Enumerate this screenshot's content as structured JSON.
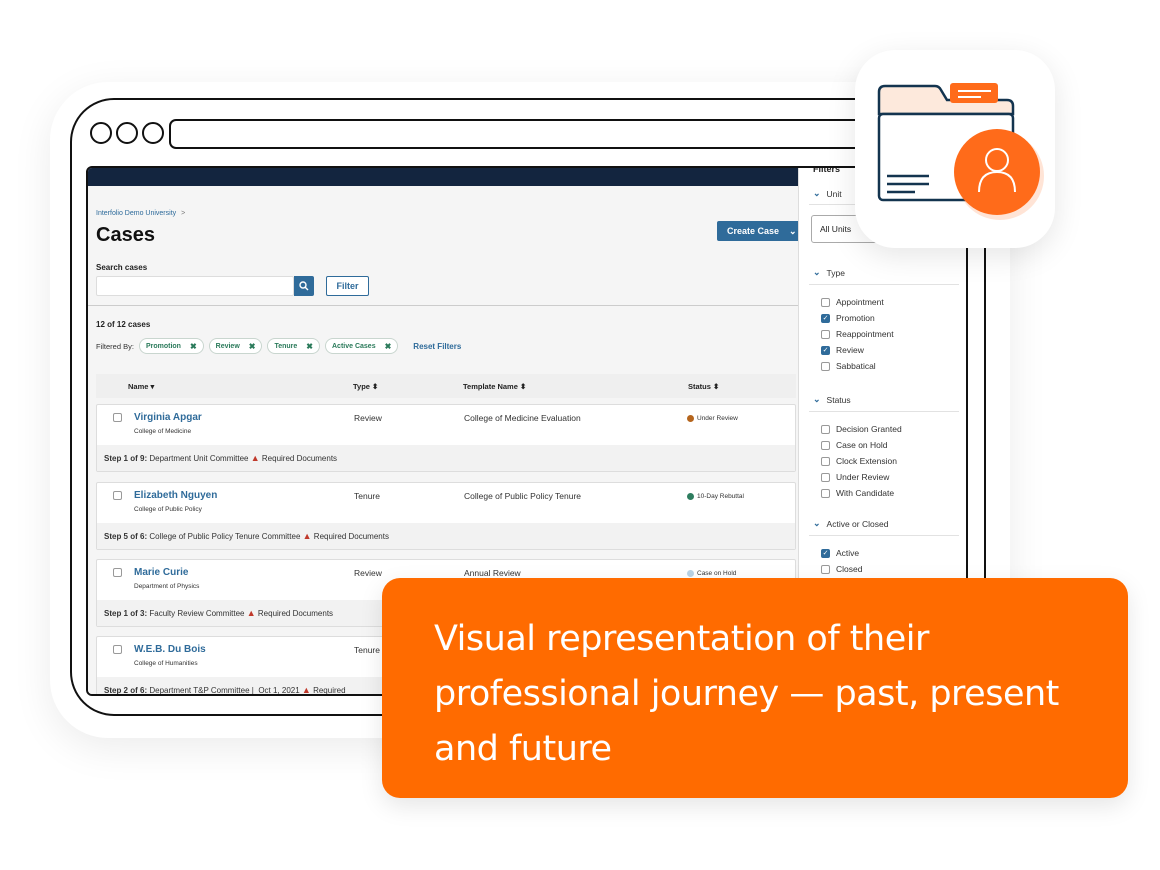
{
  "browser": {
    "window_controls": [
      "circle",
      "circle",
      "circle"
    ],
    "url": ""
  },
  "app": {
    "breadcrumb": "Interfolio Demo University",
    "breadcrumb_separator": ">",
    "page_title": "Cases",
    "create_button": "Create Case",
    "search_label": "Search cases",
    "search_value": "",
    "search_icon": "search-icon",
    "filter_button": "Filter",
    "case_count": "12 of 12 cases",
    "filtered_by_label": "Filtered By:",
    "filter_chips": [
      {
        "label": "Promotion",
        "remove": "✖"
      },
      {
        "label": "Review",
        "remove": "✖"
      },
      {
        "label": "Tenure",
        "remove": "✖"
      },
      {
        "label": "Active Cases",
        "remove": "✖"
      }
    ],
    "reset_filters": "Reset Filters",
    "table": {
      "columns": [
        {
          "label": "Name",
          "sort": "▾"
        },
        {
          "label": "Type",
          "sort": "⬍"
        },
        {
          "label": "Template Name",
          "sort": "⬍"
        },
        {
          "label": "Status",
          "sort": "⬍"
        }
      ],
      "rows": [
        {
          "name": "Virginia Apgar",
          "unit": "College of Medicine",
          "type": "Review",
          "template": "College of Medicine Evaluation",
          "status": "Under Review",
          "status_color": "#b5651d",
          "step_prefix": "Step 1 of 9:",
          "step_text": "Department Unit Committee",
          "step_date": "",
          "warning": "Required Documents"
        },
        {
          "name": "Elizabeth Nguyen",
          "unit": "College of Public Policy",
          "type": "Tenure",
          "template": "College of Public Policy Tenure",
          "status": "10-Day Rebuttal",
          "status_color": "#2e7d5f",
          "step_prefix": "Step 5 of 6:",
          "step_text": "College of Public Policy Tenure Committee",
          "step_date": "",
          "warning": "Required Documents"
        },
        {
          "name": "Marie Curie",
          "unit": "Department of Physics",
          "type": "Review",
          "template": "Annual Review",
          "status": "Case on Hold",
          "status_color": "#b9d3e6",
          "step_prefix": "Step 1 of 3:",
          "step_text": "Faculty Review Committee",
          "step_date": "",
          "warning": "Required Documents"
        },
        {
          "name": "W.E.B. Du Bois",
          "unit": "College of Humanities",
          "type": "Tenure",
          "template": "",
          "status": "",
          "status_color": "",
          "step_prefix": "Step 2 of 6:",
          "step_text": "Department T&P Committee |",
          "step_date": "Oct 1, 2021",
          "warning": "Required"
        }
      ]
    },
    "sidebar": {
      "title": "Filters",
      "unit_section": "Unit",
      "unit_select": "All Units",
      "type_section": "Type",
      "type_options": [
        {
          "label": "Appointment",
          "checked": false
        },
        {
          "label": "Promotion",
          "checked": true
        },
        {
          "label": "Reappointment",
          "checked": false
        },
        {
          "label": "Review",
          "checked": true
        },
        {
          "label": "Sabbatical",
          "checked": false
        }
      ],
      "status_section": "Status",
      "status_options": [
        {
          "label": "Decision Granted",
          "checked": false
        },
        {
          "label": "Case on Hold",
          "checked": false
        },
        {
          "label": "Clock Extension",
          "checked": false
        },
        {
          "label": "Under Review",
          "checked": false
        },
        {
          "label": "With Candidate",
          "checked": false
        }
      ],
      "active_section": "Active or Closed",
      "active_options": [
        {
          "label": "Active",
          "checked": true
        },
        {
          "label": "Closed",
          "checked": false
        }
      ]
    }
  },
  "app_icon": {
    "name": "folder-person-icon",
    "accent": "#ff6b1a",
    "outline": "#13344f"
  },
  "banner": {
    "text": "Visual representation of their professional journey — past, present and future",
    "color": "#ff6b00"
  }
}
